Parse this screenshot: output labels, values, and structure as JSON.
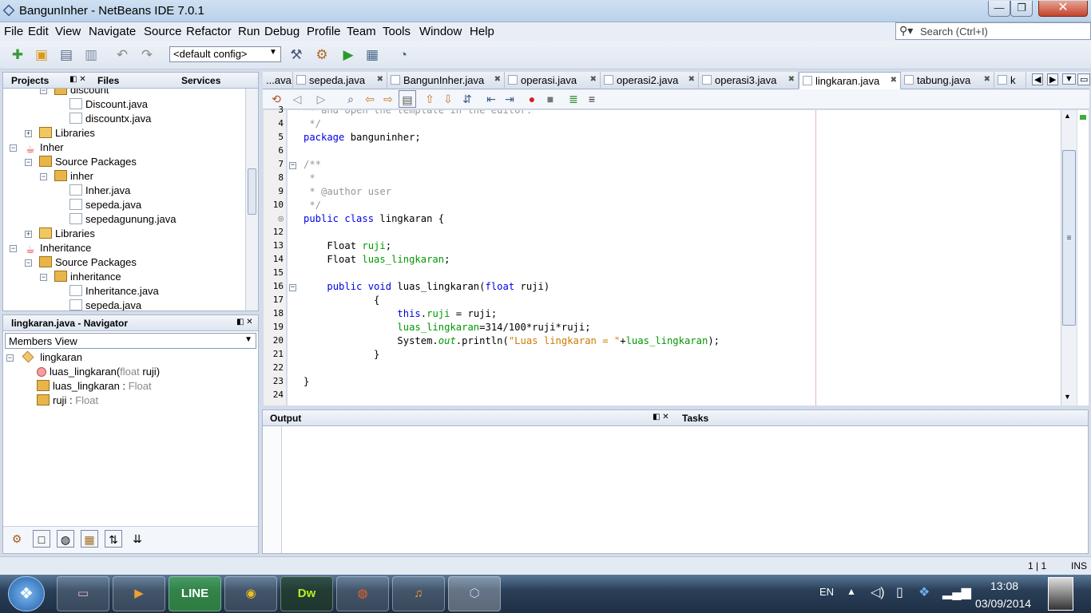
{
  "window": {
    "title": "BangunInher - NetBeans IDE 7.0.1",
    "min": "—",
    "max": "❐",
    "close": "✕"
  },
  "menu": [
    "File",
    "Edit",
    "View",
    "Navigate",
    "Source",
    "Refactor",
    "Run",
    "Debug",
    "Profile",
    "Team",
    "Tools",
    "Window",
    "Help"
  ],
  "search": {
    "placeholder": "Search (Ctrl+I)"
  },
  "toolbar": {
    "config": "<default config>"
  },
  "projects": {
    "tabs": [
      "Projects",
      "Files",
      "Services"
    ],
    "tree": [
      {
        "label": "discount",
        "level": 2,
        "icon": "package-icon",
        "toggle": "−"
      },
      {
        "label": "Discount.java",
        "level": 3,
        "icon": "java-file-icon"
      },
      {
        "label": "discountx.java",
        "level": 3,
        "icon": "java-file-icon"
      },
      {
        "label": "Libraries",
        "level": 1,
        "icon": "library-icon",
        "toggle": "+"
      },
      {
        "label": "Inher",
        "level": 0,
        "icon": "project-icon",
        "toggle": "−"
      },
      {
        "label": "Source Packages",
        "level": 1,
        "icon": "package-icon",
        "toggle": "−"
      },
      {
        "label": "inher",
        "level": 2,
        "icon": "package-icon",
        "toggle": "−"
      },
      {
        "label": "Inher.java",
        "level": 3,
        "icon": "java-file-icon"
      },
      {
        "label": "sepeda.java",
        "level": 3,
        "icon": "java-file-icon"
      },
      {
        "label": "sepedagunung.java",
        "level": 3,
        "icon": "java-file-icon"
      },
      {
        "label": "Libraries",
        "level": 1,
        "icon": "library-icon",
        "toggle": "+"
      },
      {
        "label": "Inheritance",
        "level": 0,
        "icon": "project-icon",
        "toggle": "−"
      },
      {
        "label": "Source Packages",
        "level": 1,
        "icon": "package-icon",
        "toggle": "−"
      },
      {
        "label": "inheritance",
        "level": 2,
        "icon": "package-icon",
        "toggle": "−"
      },
      {
        "label": "Inheritance.java",
        "level": 3,
        "icon": "java-file-icon"
      },
      {
        "label": "sepeda.java",
        "level": 3,
        "icon": "java-file-icon"
      }
    ]
  },
  "navigator": {
    "title": "lingkaran.java - Navigator",
    "view": "Members View",
    "class": "lingkaran",
    "members": [
      {
        "name": "luas_lingkaran(",
        "type": "float",
        "rest": " ruji)",
        "icon": "method-icon"
      },
      {
        "name": "luas_lingkaran",
        "sep": " : ",
        "type": "Float",
        "icon": "field-icon"
      },
      {
        "name": "ruji",
        "sep": " : ",
        "type": "Float",
        "icon": "field-icon"
      }
    ]
  },
  "editor": {
    "tabs": [
      "...ava",
      "sepeda.java",
      "BangunInher.java",
      "operasi.java",
      "operasi2.java",
      "operasi3.java",
      "lingkaran.java",
      "tabung.java",
      "k"
    ],
    "active_tab": "lingkaran.java",
    "lines": [
      {
        "n": "3",
        "html": "<span class='cm'> * and open the template in the editor.</span>"
      },
      {
        "n": "4",
        "html": "<span class='cm'> */</span>"
      },
      {
        "n": "5",
        "html": "<span class='kw'>package</span> banguninher;"
      },
      {
        "n": "6",
        "html": ""
      },
      {
        "n": "7",
        "html": "<span class='cm'>/**</span>"
      },
      {
        "n": "8",
        "html": "<span class='cm'> *</span>"
      },
      {
        "n": "9",
        "html": "<span class='cm'> * @author user</span>"
      },
      {
        "n": "10",
        "html": "<span class='cm'> */</span>"
      },
      {
        "n": "",
        "html": "<span class='kw'>public class</span> lingkaran {"
      },
      {
        "n": "12",
        "html": ""
      },
      {
        "n": "13",
        "html": "    Float <span class='fd'>ruji</span>;"
      },
      {
        "n": "14",
        "html": "    Float <span class='fd'>luas_lingkaran</span>;"
      },
      {
        "n": "15",
        "html": ""
      },
      {
        "n": "16",
        "html": "    <span class='kw'>public void</span> luas_lingkaran(<span class='kw'>float</span> ruji)"
      },
      {
        "n": "17",
        "html": "            {"
      },
      {
        "n": "18",
        "html": "                <span class='kw'>this</span>.<span class='fd'>ruji</span> = ruji;"
      },
      {
        "n": "19",
        "html": "                <span class='fd'>luas_lingkaran</span>=314/100*ruji*ruji;"
      },
      {
        "n": "20",
        "html": "                System.<span class='fd it'>out</span>.println(<span class='st'>\"Luas lingkaran = \"</span>+<span class='fd'>luas_lingkaran</span>);"
      },
      {
        "n": "21",
        "html": "            }"
      },
      {
        "n": "22",
        "html": ""
      },
      {
        "n": "23",
        "html": "}"
      },
      {
        "n": "24",
        "html": ""
      }
    ]
  },
  "bottom": {
    "output": "Output",
    "tasks": "Tasks"
  },
  "status": {
    "position": "1 | 1",
    "mode": "INS"
  },
  "taskbar": {
    "apps": [
      "folder",
      "media",
      "LINE",
      "chrome",
      "Dw",
      "firefox",
      "music",
      "netbeans"
    ],
    "lang": "EN",
    "time": "13:08",
    "date": "03/09/2014"
  }
}
